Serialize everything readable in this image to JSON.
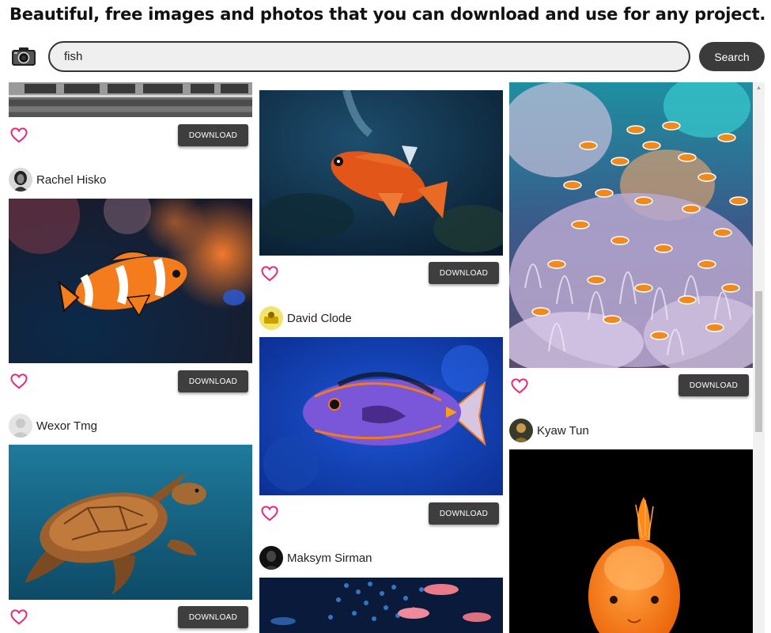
{
  "header": {
    "title": "Beautiful, free images and photos that you can download and use for any project."
  },
  "search": {
    "value": "fish",
    "button_label": "Search"
  },
  "icons": {
    "logo": "camera-icon",
    "like": "heart-icon",
    "scroll": "arrow-up-icon"
  },
  "colors": {
    "heart": "#e8287a",
    "download_button": "#3e3e3e",
    "search_button": "#3b3b3b"
  },
  "download_label": "DOWNLOAD",
  "columns": [
    {
      "cards": [
        {
          "photo": "wooden-planks-photo",
          "author": null
        },
        {
          "photo": "clownfish-photo",
          "author": "Rachel Hisko"
        },
        {
          "photo": "sea-turtle-photo",
          "author": "Wexor Tmg"
        }
      ]
    },
    {
      "cards": [
        {
          "photo": "orange-rockfish-photo",
          "author": null
        },
        {
          "photo": "blue-tang-photo",
          "author": "David Clode"
        },
        {
          "photo": "aquarium-fish-school-photo",
          "author": "Maksym Sirman"
        }
      ]
    },
    {
      "cards": [
        {
          "photo": "clownfish-anemone-reef-photo",
          "author": null
        },
        {
          "photo": "goldfish-black-background-photo",
          "author": "Kyaw Tun"
        }
      ]
    }
  ]
}
